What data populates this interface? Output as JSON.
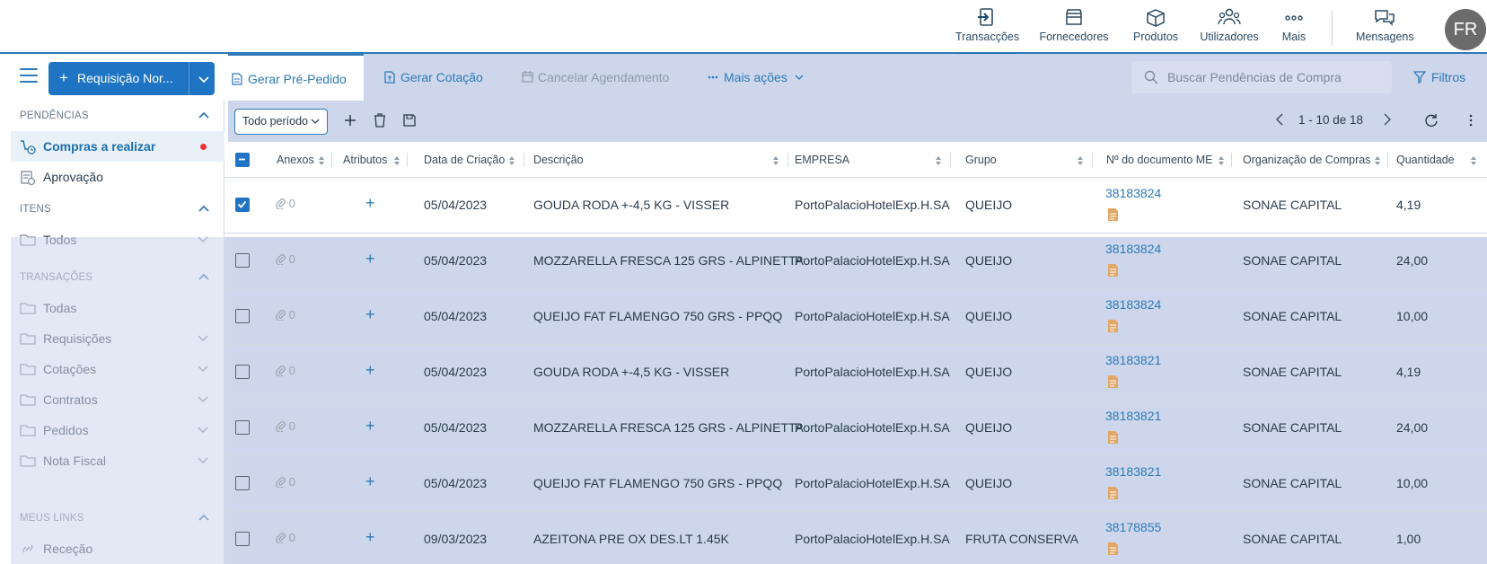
{
  "topnav": {
    "items": [
      {
        "label": "Transacções",
        "icon": "transactions-icon",
        "active": true
      },
      {
        "label": "Fornecedores",
        "icon": "store-icon"
      },
      {
        "label": "Produtos",
        "icon": "box-icon"
      },
      {
        "label": "Utilizadores",
        "icon": "users-icon"
      },
      {
        "label": "Mais",
        "icon": "more-dots-icon"
      },
      {
        "label": "Mensagens",
        "icon": "chat-icon"
      }
    ],
    "avatar": "FR"
  },
  "sidebar": {
    "new_button": "Requisição Nor...",
    "sections": [
      {
        "title": "PENDÊNCIAS",
        "items": [
          {
            "label": "Compras a realizar"
          },
          {
            "label": "Aprovação"
          }
        ]
      },
      {
        "title": "ITENS",
        "items": [
          {
            "label": "Todos"
          }
        ]
      },
      {
        "title": "TRANSAÇÕES",
        "items": [
          {
            "label": "Todas"
          },
          {
            "label": "Requisições"
          },
          {
            "label": "Cotações"
          },
          {
            "label": "Contratos"
          },
          {
            "label": "Pedidos"
          },
          {
            "label": "Nota Fiscal"
          }
        ]
      },
      {
        "title": "MEUS LINKS",
        "items": [
          {
            "label": "Receção"
          }
        ]
      }
    ]
  },
  "actions": {
    "gerar_pre_pedido": "Gerar Pré-Pedido",
    "gerar_cotacao": "Gerar Cotação",
    "cancelar_agendamento": "Cancelar Agendamento",
    "mais_acoes": "Mais ações",
    "search_placeholder": "Buscar Pendências de Compra",
    "filtros": "Filtros"
  },
  "toolbar": {
    "period": "Todo período",
    "pager": "1 - 10 de 18"
  },
  "table": {
    "headers": [
      "Anexos",
      "Atributos",
      "Data de Criação",
      "Descrição",
      "EMPRESA",
      "Grupo",
      "Nº do documento ME",
      "Organização de Compras",
      "Quantidade"
    ],
    "rows": [
      {
        "checked": true,
        "anexos": "0",
        "data": "05/04/2023",
        "descricao": "GOUDA RODA +-4,5 KG - VISSER",
        "empresa": "PortoPalacioHotelExp.H.SA",
        "grupo": "QUEIJO",
        "doc": "38183824",
        "org": "SONAE CAPITAL",
        "qtd": "4,19"
      },
      {
        "checked": false,
        "anexos": "0",
        "data": "05/04/2023",
        "descricao": "MOZZARELLA FRESCA 125 GRS - ALPINETTA",
        "empresa": "PortoPalacioHotelExp.H.SA",
        "grupo": "QUEIJO",
        "doc": "38183824",
        "org": "SONAE CAPITAL",
        "qtd": "24,00"
      },
      {
        "checked": false,
        "anexos": "0",
        "data": "05/04/2023",
        "descricao": "QUEIJO FAT FLAMENGO 750 GRS - PPQQ",
        "empresa": "PortoPalacioHotelExp.H.SA",
        "grupo": "QUEIJO",
        "doc": "38183824",
        "org": "SONAE CAPITAL",
        "qtd": "10,00"
      },
      {
        "checked": false,
        "anexos": "0",
        "data": "05/04/2023",
        "descricao": "GOUDA RODA +-4,5 KG - VISSER",
        "empresa": "PortoPalacioHotelExp.H.SA",
        "grupo": "QUEIJO",
        "doc": "38183821",
        "org": "SONAE CAPITAL",
        "qtd": "4,19"
      },
      {
        "checked": false,
        "anexos": "0",
        "data": "05/04/2023",
        "descricao": "MOZZARELLA FRESCA 125 GRS - ALPINETTA",
        "empresa": "PortoPalacioHotelExp.H.SA",
        "grupo": "QUEIJO",
        "doc": "38183821",
        "org": "SONAE CAPITAL",
        "qtd": "24,00"
      },
      {
        "checked": false,
        "anexos": "0",
        "data": "05/04/2023",
        "descricao": "QUEIJO FAT FLAMENGO 750 GRS - PPQQ",
        "empresa": "PortoPalacioHotelExp.H.SA",
        "grupo": "QUEIJO",
        "doc": "38183821",
        "org": "SONAE CAPITAL",
        "qtd": "10,00"
      },
      {
        "checked": false,
        "anexos": "0",
        "data": "09/03/2023",
        "descricao": "AZEITONA PRE OX DES.LT 1.45K",
        "empresa": "PortoPalacioHotelExp.H.SA",
        "grupo": "FRUTA CONSERVA",
        "doc": "38178855",
        "org": "SONAE CAPITAL",
        "qtd": "1,00"
      }
    ]
  },
  "colors": {
    "accent": "#1f75c4",
    "highlight": "#cdd6eb",
    "link": "#2f7ab8",
    "doc_icon": "#e0a866"
  }
}
